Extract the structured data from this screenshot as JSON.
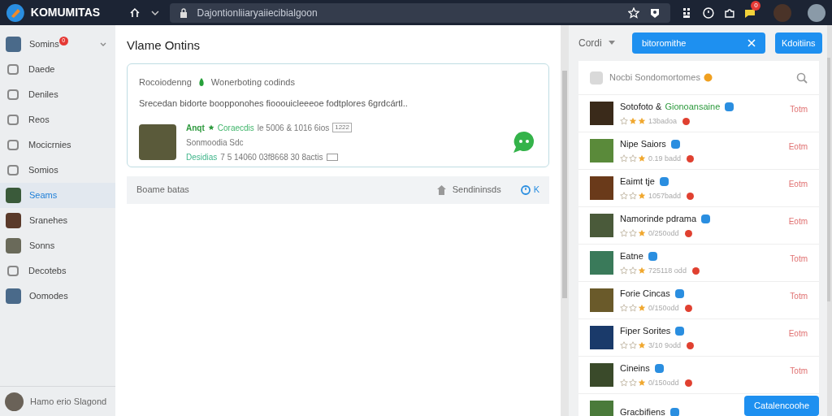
{
  "topbar": {
    "brand": "KOMUMITAS",
    "url": "Dajontionliiaryaiiecibialgoon",
    "notification_count": "0"
  },
  "sidebar": {
    "items": [
      {
        "label": "Somins",
        "badge": "0",
        "selected": false,
        "kind": "photo",
        "chevron": true
      },
      {
        "label": "Daede",
        "selected": false,
        "kind": "icon"
      },
      {
        "label": "Deniles",
        "selected": false,
        "kind": "icon"
      },
      {
        "label": "Reos",
        "selected": false,
        "kind": "icon"
      },
      {
        "label": "Mocicrnies",
        "selected": false,
        "kind": "icon"
      },
      {
        "label": "Somios",
        "selected": false,
        "kind": "icon"
      },
      {
        "label": "Seams",
        "selected": true,
        "kind": "photo"
      },
      {
        "label": "Sranehes",
        "selected": false,
        "kind": "photo"
      },
      {
        "label": "Sonns",
        "selected": false,
        "kind": "photo"
      },
      {
        "label": "Decotebs",
        "selected": false,
        "kind": "icon"
      },
      {
        "label": "Oomodes",
        "selected": false,
        "kind": "photo"
      }
    ],
    "footer": "Hamo erio Slagond"
  },
  "main": {
    "title": "Vlame Ontins",
    "card": {
      "source": "Rocoiodenng",
      "tag": "Wonerboting codinds",
      "description": "Srecedan bidorte boopponohes fiooouicleeeoe fodtplores 6grdcártl..",
      "item": {
        "name": "Anqt",
        "category": "Coraecdis",
        "meta": "le 5006 & 1016 6ios",
        "meta_box": "1222",
        "subtitle": "Sonmoodia Sdc",
        "status": "Desidias",
        "detail": "7 5 14060 03f8668 30 8actis"
      }
    },
    "bar": {
      "label": "Boame batas",
      "action": "Sendininsds",
      "close": "K"
    }
  },
  "panel": {
    "dropdown": "Cordi",
    "search_value": "bitoromithe",
    "button": "Kdoitiins",
    "filter_placeholder": "Nocbi Sondomortomes",
    "results": [
      {
        "name": "Sotofoto &",
        "name_highlight": "Gionoansaine",
        "stars": 2,
        "meta": "13badoa",
        "time": "Totm"
      },
      {
        "name": "Nipe Saiors",
        "stars": 1,
        "meta": "0.19 badd",
        "time": "Eotm"
      },
      {
        "name": "Eaimt tje",
        "stars": 1,
        "meta": "1057badd",
        "time": "Eotm"
      },
      {
        "name": "Namorinde pdrama",
        "stars": 1,
        "meta": "0/250odd",
        "time": "Eotm"
      },
      {
        "name": "Eatne",
        "stars": 1,
        "meta": "725118 odd",
        "time": "Totm"
      },
      {
        "name": "Forie Cincas",
        "stars": 1,
        "meta": "0/150odd",
        "time": "Totm"
      },
      {
        "name": "Fiper Sorites",
        "stars": 1,
        "meta": "3/10 9odd",
        "time": "Eotm"
      },
      {
        "name": "Cineins",
        "stars": 1,
        "meta": "0/150odd",
        "time": "Totm"
      },
      {
        "name": "Gracbifiens"
      }
    ],
    "floating_button": "Catalencoohe"
  }
}
